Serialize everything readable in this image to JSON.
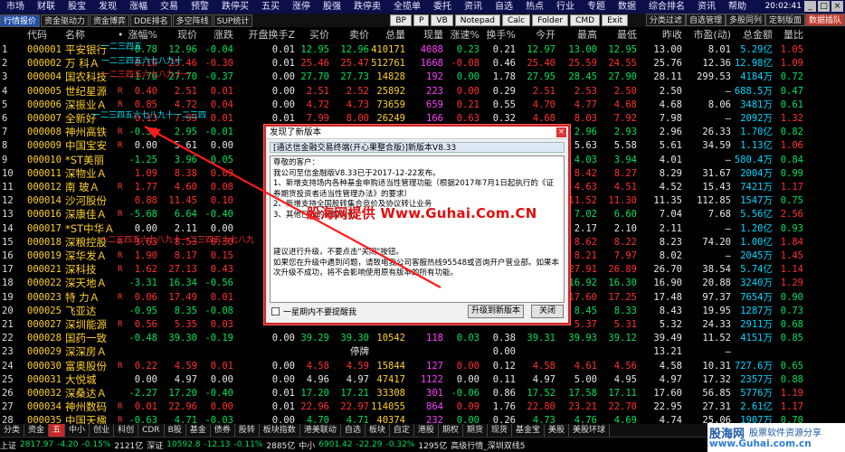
{
  "menubar": {
    "items": [
      "市场",
      "财联",
      "股宝",
      "发现",
      "涨幅",
      "交易",
      "预警",
      "跌停买",
      "五买",
      "涨停",
      "股强",
      "跌停卖",
      "全揽单",
      "委托",
      "资讯",
      "自选",
      "热点",
      "行业",
      "专题",
      "数据",
      "综合排名",
      "资讯",
      "帮助"
    ],
    "clock": "20:02:41",
    "window_buttons": [
      "_",
      "□",
      "×"
    ]
  },
  "toolbar": {
    "tabs": [
      "行情报价",
      "资金驱动力",
      "资金博弈",
      "DDE排名",
      "多空阵线",
      "SUP统计"
    ],
    "tools": [
      "BP",
      "P",
      "VB",
      "Notepad",
      "Calc",
      "Folder",
      "CMD",
      "Exit"
    ],
    "right_tabs": [
      "分类过滤",
      "自选管理",
      "多股同列",
      "定制版面",
      "数据插队"
    ]
  },
  "table": {
    "headers": [
      "代码",
      "名称",
      "•",
      "涨幅%",
      "现价",
      "涨跌",
      "开盘换手Z",
      "买价",
      "卖价",
      "总量",
      "现量",
      "涨速%",
      "换手%",
      "今开",
      "最高",
      "最低",
      "昨收",
      "市盈(动)",
      "总金额",
      "量比"
    ],
    "rows": [
      {
        "idx": "1",
        "code": "000001",
        "name": "平安银行",
        "flag": "",
        "chg": "-0.78",
        "price": "12.96",
        "diff": "-0.04",
        "open_turn": "0.01",
        "bid": "12.95",
        "ask": "12.96",
        "vol": "410171",
        "cur": "4088",
        "speed": "0.23",
        "turn": "0.21",
        "open": "12.97",
        "high": "13.00",
        "low": "12.95",
        "prev": "13.00",
        "pe": "8.01",
        "amount": "5.29亿",
        "ratio": "1.05"
      },
      {
        "idx": "2",
        "code": "000002",
        "name": "万 科Ａ",
        "flag": "",
        "chg": "0.10",
        "price": "25.46",
        "diff": "-0.30",
        "open_turn": "0.01",
        "bid": "25.46",
        "ask": "25.47",
        "vol": "512761",
        "cur": "1668",
        "speed": "-0.08",
        "turn": "0.46",
        "open": "25.40",
        "high": "25.59",
        "low": "24.55",
        "prev": "25.76",
        "pe": "12.36",
        "amount": "12.98亿",
        "ratio": "1.09"
      },
      {
        "idx": "3",
        "code": "000004",
        "name": "国农科技",
        "flag": "",
        "chg": "-1.70",
        "price": "27.70",
        "diff": "-0.37",
        "open_turn": "0.00",
        "bid": "27.70",
        "ask": "27.73",
        "vol": "14828",
        "cur": "192",
        "speed": "0.00",
        "turn": "1.78",
        "open": "27.95",
        "high": "28.45",
        "low": "27.90",
        "prev": "28.11",
        "pe": "299.53",
        "amount": "4184万",
        "ratio": "0.72"
      },
      {
        "idx": "4",
        "code": "000005",
        "name": "世纪星源",
        "flag": "R",
        "chg": "0.40",
        "price": "2.51",
        "diff": "0.01",
        "open_turn": "0.00",
        "bid": "2.51",
        "ask": "2.52",
        "vol": "25892",
        "cur": "223",
        "speed": "0.00",
        "turn": "0.29",
        "open": "2.51",
        "high": "2.53",
        "low": "2.50",
        "prev": "2.50",
        "pe": "—",
        "amount": "688.5万",
        "ratio": "0.47"
      },
      {
        "idx": "5",
        "code": "000006",
        "name": "深振业Ａ",
        "flag": "R",
        "chg": "0.85",
        "price": "4.72",
        "diff": "0.04",
        "open_turn": "0.00",
        "bid": "4.72",
        "ask": "4.73",
        "vol": "73659",
        "cur": "659",
        "speed": "0.21",
        "turn": "0.55",
        "open": "4.70",
        "high": "4.77",
        "low": "4.68",
        "prev": "4.68",
        "pe": "8.06",
        "amount": "3481万",
        "ratio": "0.61"
      },
      {
        "idx": "6",
        "code": "000007",
        "name": "全新好",
        "flag": "",
        "chg": "0.13",
        "price": "7.99",
        "diff": "0.01",
        "open_turn": "0.01",
        "bid": "7.99",
        "ask": "8.00",
        "vol": "26249",
        "cur": "166",
        "speed": "0.63",
        "turn": "0.32",
        "open": "4.68",
        "high": "8.03",
        "low": "7.92",
        "prev": "7.98",
        "pe": "—",
        "amount": "2092万",
        "ratio": "1.32"
      },
      {
        "idx": "7",
        "code": "000008",
        "name": "神州高铁",
        "flag": "R",
        "chg": "-0.34",
        "price": "2.95",
        "diff": "-0.01",
        "open_turn": "",
        "bid": "",
        "ask": "",
        "vol": "",
        "cur": "",
        "speed": "",
        "turn": "",
        "open": "",
        "high": "2.96",
        "low": "2.93",
        "prev": "2.96",
        "pe": "26.33",
        "amount": "1.70亿",
        "ratio": "0.82"
      },
      {
        "idx": "8",
        "code": "000009",
        "name": "中国宝安",
        "flag": "R",
        "chg": "0.00",
        "price": "5.61",
        "diff": "0.00",
        "open_turn": "",
        "bid": "",
        "ask": "",
        "vol": "",
        "cur": "",
        "speed": "",
        "turn": "",
        "open": "",
        "high": "5.63",
        "low": "5.58",
        "prev": "5.61",
        "pe": "34.59",
        "amount": "1.13亿",
        "ratio": "1.06"
      },
      {
        "idx": "9",
        "code": "000010",
        "name": "*ST美丽",
        "flag": "",
        "chg": "-1.25",
        "price": "3.96",
        "diff": "-0.05",
        "open_turn": "",
        "bid": "",
        "ask": "",
        "vol": "",
        "cur": "",
        "speed": "",
        "turn": "",
        "open": "",
        "high": "4.03",
        "low": "3.94",
        "prev": "4.01",
        "pe": "—",
        "amount": "580.4万",
        "ratio": "0.84"
      },
      {
        "idx": "10",
        "code": "000011",
        "name": "深物业Ａ",
        "flag": "",
        "chg": "1.09",
        "price": "8.38",
        "diff": "0.09",
        "open_turn": "",
        "bid": "",
        "ask": "",
        "vol": "",
        "cur": "",
        "speed": "",
        "turn": "",
        "open": "",
        "high": "8.42",
        "low": "8.27",
        "prev": "8.29",
        "pe": "31.67",
        "amount": "2004万",
        "ratio": "0.99"
      },
      {
        "idx": "11",
        "code": "000012",
        "name": "南 玻Ａ",
        "flag": "R",
        "chg": "1.77",
        "price": "4.60",
        "diff": "0.08",
        "open_turn": "",
        "bid": "",
        "ask": "",
        "vol": "",
        "cur": "",
        "speed": "",
        "turn": "",
        "open": "",
        "high": "4.63",
        "low": "4.51",
        "prev": "4.52",
        "pe": "15.43",
        "amount": "7421万",
        "ratio": "1.17"
      },
      {
        "idx": "12",
        "code": "000014",
        "name": "沙河股份",
        "flag": "",
        "chg": "0.88",
        "price": "11.45",
        "diff": "0.10",
        "open_turn": "",
        "bid": "",
        "ask": "",
        "vol": "",
        "cur": "",
        "speed": "",
        "turn": "",
        "open": "",
        "high": "11.52",
        "low": "11.30",
        "prev": "11.35",
        "pe": "112.85",
        "amount": "1547万",
        "ratio": "0.75"
      },
      {
        "idx": "13",
        "code": "000016",
        "name": "深康佳Ａ",
        "flag": "R",
        "chg": "-5.68",
        "price": "6.64",
        "diff": "-0.40",
        "open_turn": "",
        "bid": "",
        "ask": "",
        "vol": "",
        "cur": "",
        "speed": "",
        "turn": "",
        "open": "",
        "high": "7.02",
        "low": "6.60",
        "prev": "7.04",
        "pe": "7.68",
        "amount": "5.56亿",
        "ratio": "2.56"
      },
      {
        "idx": "14",
        "code": "000017",
        "name": "*ST中华Ａ",
        "flag": "",
        "chg": "0.00",
        "price": "2.11",
        "diff": "0.00",
        "open_turn": "",
        "bid": "",
        "ask": "",
        "vol": "",
        "cur": "",
        "speed": "",
        "turn": "",
        "open": "",
        "high": "2.17",
        "low": "2.10",
        "prev": "2.11",
        "pe": "—",
        "amount": "1.20亿",
        "ratio": "0.93"
      },
      {
        "idx": "15",
        "code": "000018",
        "name": "深粮控股",
        "flag": "R",
        "chg": "3.63",
        "price": "8.53",
        "diff": "0.30",
        "open_turn": "",
        "bid": "",
        "ask": "",
        "vol": "",
        "cur": "",
        "speed": "",
        "turn": "",
        "open": "",
        "high": "8.62",
        "low": "8.22",
        "prev": "8.23",
        "pe": "74.20",
        "amount": "1.00亿",
        "ratio": "1.84"
      },
      {
        "idx": "16",
        "code": "000019",
        "name": "深华发Ａ",
        "flag": "R",
        "chg": "1.90",
        "price": "8.17",
        "diff": "0.15",
        "open_turn": "",
        "bid": "",
        "ask": "",
        "vol": "",
        "cur": "",
        "speed": "",
        "turn": "",
        "open": "",
        "high": "8.21",
        "low": "7.97",
        "prev": "8.02",
        "pe": "—",
        "amount": "2045万",
        "ratio": "1.45"
      },
      {
        "idx": "17",
        "code": "000021",
        "name": "深科技",
        "flag": "R",
        "chg": "1.62",
        "price": "27.13",
        "diff": "0.43",
        "open_turn": "",
        "bid": "",
        "ask": "",
        "vol": "",
        "cur": "",
        "speed": "",
        "turn": "",
        "open": "",
        "high": "27.91",
        "low": "26.89",
        "prev": "26.70",
        "pe": "38.54",
        "amount": "5.74亿",
        "ratio": "1.14"
      },
      {
        "idx": "18",
        "code": "000022",
        "name": "深天地Ａ",
        "flag": "",
        "chg": "-3.31",
        "price": "16.34",
        "diff": "-0.56",
        "open_turn": "",
        "bid": "",
        "ask": "",
        "vol": "",
        "cur": "",
        "speed": "",
        "turn": "",
        "open": "",
        "high": "16.92",
        "low": "16.30",
        "prev": "16.90",
        "pe": "20.88",
        "amount": "3240万",
        "ratio": "1.29"
      },
      {
        "idx": "19",
        "code": "000023",
        "name": "特 力Ａ",
        "flag": "R",
        "chg": "0.06",
        "price": "17.49",
        "diff": "0.01",
        "open_turn": "",
        "bid": "",
        "ask": "",
        "vol": "",
        "cur": "",
        "speed": "",
        "turn": "",
        "open": "",
        "high": "17.60",
        "low": "17.25",
        "prev": "17.48",
        "pe": "97.37",
        "amount": "7654万",
        "ratio": "0.90"
      },
      {
        "idx": "20",
        "code": "000025",
        "name": "飞亚达",
        "flag": "",
        "chg": "-0.95",
        "price": "8.35",
        "diff": "-0.08",
        "open_turn": "",
        "bid": "",
        "ask": "",
        "vol": "",
        "cur": "",
        "speed": "",
        "turn": "",
        "open": "",
        "high": "8.45",
        "low": "8.33",
        "prev": "8.43",
        "pe": "19.95",
        "amount": "1287万",
        "ratio": "0.73"
      },
      {
        "idx": "21",
        "code": "000027",
        "name": "深圳能源",
        "flag": "R",
        "chg": "0.56",
        "price": "5.35",
        "diff": "0.03",
        "open_turn": "",
        "bid": "",
        "ask": "",
        "vol": "",
        "cur": "",
        "speed": "",
        "turn": "",
        "open": "",
        "high": "5.37",
        "low": "5.31",
        "prev": "5.32",
        "pe": "24.33",
        "amount": "2911万",
        "ratio": "0.68"
      },
      {
        "idx": "22",
        "code": "000028",
        "name": "国药一致",
        "flag": "",
        "chg": "-0.48",
        "price": "39.30",
        "diff": "-0.19",
        "open_turn": "0.00",
        "bid": "39.29",
        "ask": "39.30",
        "vol": "10542",
        "cur": "118",
        "speed": "0.03",
        "turn": "0.38",
        "open": "39.31",
        "high": "39.93",
        "low": "39.12",
        "prev": "39.49",
        "pe": "11.52",
        "amount": "4151万",
        "ratio": "0.85"
      },
      {
        "idx": "23",
        "code": "000029",
        "name": "深深房Ａ",
        "flag": "",
        "chg": "",
        "price": "",
        "diff": "",
        "open_turn": "",
        "bid": "",
        "ask": "停牌",
        "vol": "",
        "cur": "",
        "speed": "",
        "turn": "0.00",
        "open": "",
        "high": "",
        "low": "",
        "prev": "13.21",
        "pe": "—",
        "amount": "",
        "ratio": ""
      },
      {
        "idx": "24",
        "code": "000030",
        "name": "富奥股份",
        "flag": "R",
        "chg": "0.22",
        "price": "4.59",
        "diff": "0.01",
        "open_turn": "0.00",
        "bid": "4.58",
        "ask": "4.59",
        "vol": "15844",
        "cur": "127",
        "speed": "0.00",
        "turn": "0.12",
        "open": "4.58",
        "high": "4.61",
        "low": "4.56",
        "prev": "4.58",
        "pe": "10.31",
        "amount": "727.6万",
        "ratio": "0.65"
      },
      {
        "idx": "25",
        "code": "000031",
        "name": "大悦城",
        "flag": "",
        "chg": "0.00",
        "price": "4.97",
        "diff": "0.00",
        "open_turn": "0.00",
        "bid": "4.96",
        "ask": "4.97",
        "vol": "47417",
        "cur": "1122",
        "speed": "0.00",
        "turn": "0.11",
        "open": "4.97",
        "high": "5.00",
        "low": "4.95",
        "prev": "4.97",
        "pe": "17.32",
        "amount": "2357万",
        "ratio": "0.88"
      },
      {
        "idx": "26",
        "code": "000032",
        "name": "深桑达Ａ",
        "flag": "",
        "chg": "-2.27",
        "price": "17.20",
        "diff": "-0.40",
        "open_turn": "0.01",
        "bid": "17.20",
        "ask": "17.21",
        "vol": "33308",
        "cur": "301",
        "speed": "-0.06",
        "turn": "0.86",
        "open": "17.52",
        "high": "17.58",
        "low": "17.11",
        "prev": "17.60",
        "pe": "56.85",
        "amount": "5776万",
        "ratio": "1.19"
      },
      {
        "idx": "27",
        "code": "000034",
        "name": "神州数码",
        "flag": "R",
        "chg": "0.01",
        "price": "22.96",
        "diff": "0.00",
        "open_turn": "0.01",
        "bid": "22.96",
        "ask": "22.97",
        "vol": "114055",
        "cur": "864",
        "speed": "0.09",
        "turn": "1.76",
        "open": "22.80",
        "high": "23.21",
        "low": "22.70",
        "prev": "22.95",
        "pe": "27.31",
        "amount": "2.61亿",
        "ratio": "1.17"
      },
      {
        "idx": "28",
        "code": "000035",
        "name": "中国天楹",
        "flag": "R",
        "chg": "-0.63",
        "price": "4.71",
        "diff": "-0.03",
        "open_turn": "0.00",
        "bid": "4.70",
        "ask": "4.71",
        "vol": "40374",
        "cur": "232",
        "speed": "0.00",
        "turn": "0.26",
        "open": "4.73",
        "high": "4.76",
        "low": "4.69",
        "prev": "4.74",
        "pe": "25.06",
        "amount": "1907万",
        "ratio": "0.70"
      }
    ]
  },
  "annotations": [
    "一二三四五",
    "一二三四五六七八九十",
    "一二三四五六七八九十一",
    "一二三四五六七八九十一二三四",
    "一二三四五六七八九十一二三四五六七八九"
  ],
  "dialog": {
    "title": "发现了新版本",
    "close": "×",
    "header": "[通达信金融交易终端(开心果整合版)]新版本V8.33",
    "body": [
      "尊敬的客户：",
      "    我公司至信金融版V8.33已于2017-12-22发布。",
      "    1、新增支持场内各种基金申购适当性管理功能（根据2017年7月1日起执行的《证券期货投资者适当性管理办法》的要求）",
      "    2、新增支持全国股转集合竞价及协议转让业务",
      "    3、其他已知的问题优化。",
      "建议进行升级，不要点击\"关闭\"按钮。",
      "如果您在升级中遇到问题，请致电我公司客服热线95548或咨询开户营业部。如果本次升级不成功，将不会影响使用原有版本的所有功能。"
    ],
    "watermark": "股海网提供 Www.Guhai.Com.CN",
    "checkbox_label": "一星期内不要提醒我",
    "upgrade_btn": "升级到新版本",
    "close_btn": "关闭"
  },
  "bottom_tabs": [
    "分类",
    "资金",
    "五",
    "中小",
    "创业",
    "科创",
    "CDR",
    "B股",
    "基金",
    "债券",
    "股转",
    "板块指数",
    "港美联动",
    "自选",
    "板块",
    "自定",
    "港股",
    "期权",
    "期货",
    "现货",
    "基金宝",
    "美股",
    "美股环球"
  ],
  "status": {
    "sh_label": "上证",
    "sh_val": "2817.97",
    "sh_chg": "-4.20",
    "sh_pct": "-0.15%",
    "sh_amt": "2121亿",
    "sz_label": "深证",
    "sz_val": "10592.8",
    "sz_chg": "-12.13",
    "sz_pct": "-0.11%",
    "sz_amt": "2885亿",
    "zx_label": "中小",
    "zx_val": "6901.42",
    "zx_chg": "-22.29",
    "zx_pct": "-0.32%",
    "zx_amt": "1295亿",
    "market": "高级行情_深圳双线5"
  },
  "logo": {
    "main": "股海网",
    "tagline": "股票软件资源分享",
    "url": "www.Guhai.com.cn"
  },
  "colors": {
    "up": "#ff3030",
    "down": "#00e05a",
    "code": "#ffd02a",
    "dialog_border": "#c62828"
  }
}
